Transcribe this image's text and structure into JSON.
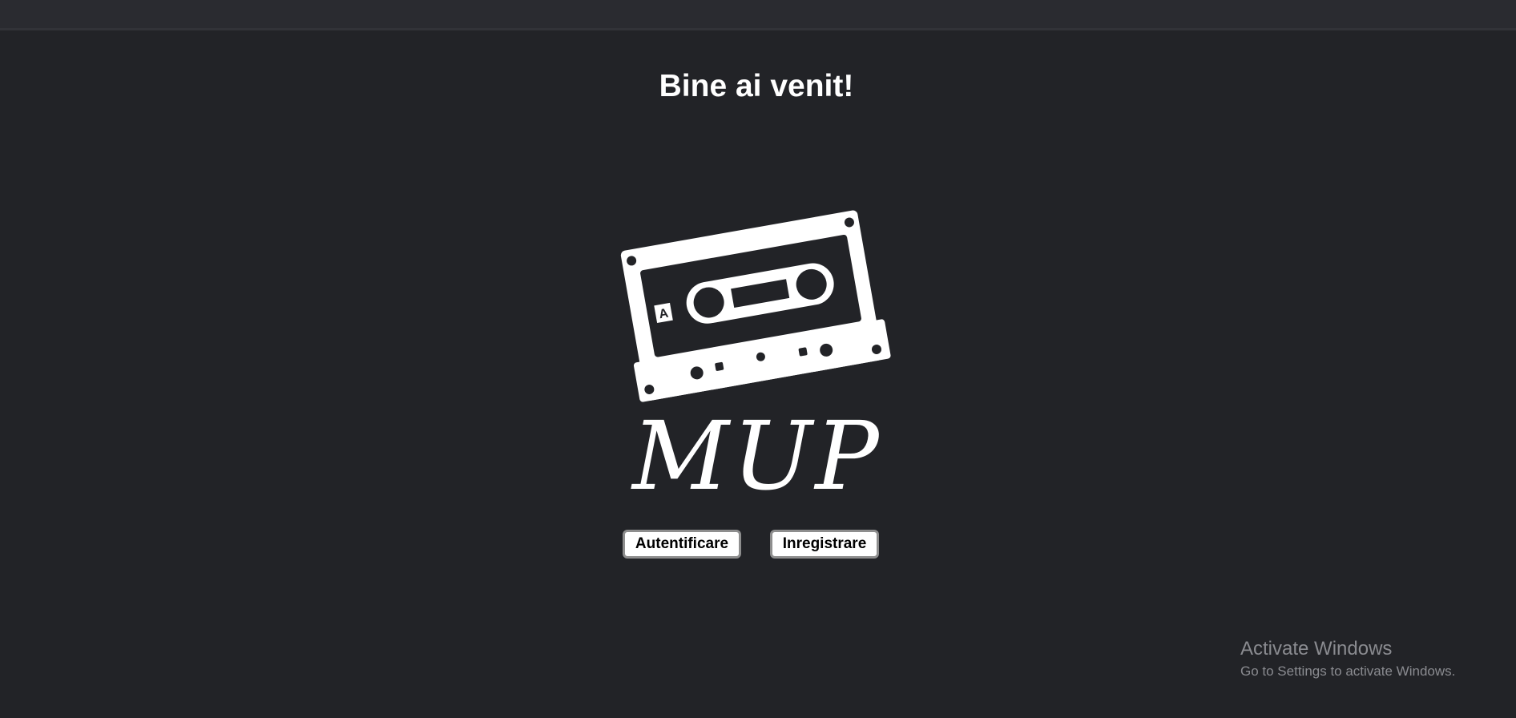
{
  "page": {
    "heading": "Bine ai venit!",
    "background_color": "#222327",
    "topbar_color": "#2a2b30"
  },
  "logo": {
    "icon": "cassette-tape-icon",
    "side_label": "A",
    "wordmark": "MUP",
    "color": "#ffffff"
  },
  "actions": {
    "login_label": "Autentificare",
    "register_label": "Inregistrare"
  },
  "watermark": {
    "title": "Activate Windows",
    "subtitle": "Go to Settings to activate Windows."
  }
}
